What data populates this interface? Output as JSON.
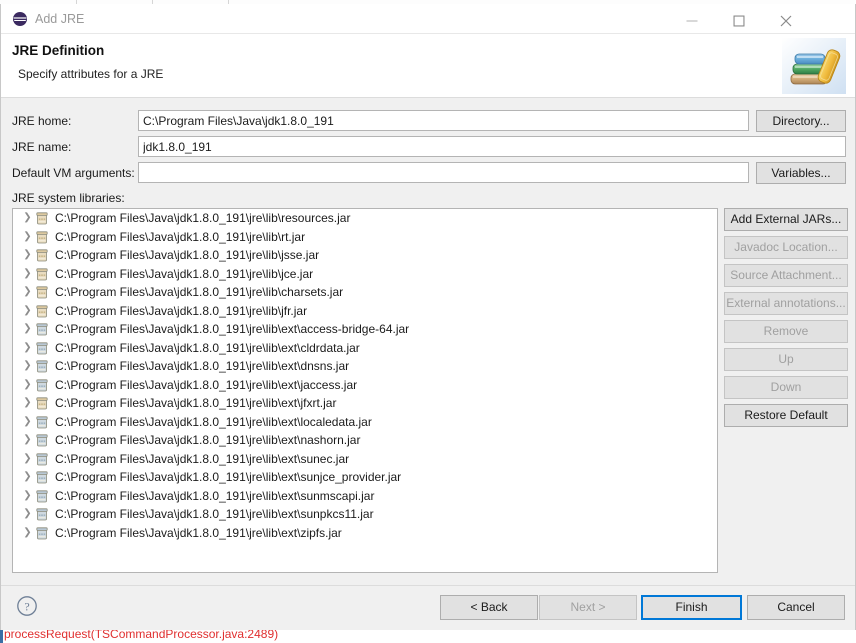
{
  "window": {
    "title": "Add JRE",
    "icon": "eclipse-icon",
    "minimize_label": "Minimize",
    "maximize_label": "Maximize",
    "close_label": "Close"
  },
  "header": {
    "title": "JRE Definition",
    "subtitle": "Specify attributes for a JRE",
    "image": "books-stack-icon"
  },
  "form": {
    "jre_home": {
      "label": "JRE home:",
      "value": "C:\\Program Files\\Java\\jdk1.8.0_191",
      "placeholder": ""
    },
    "jre_name": {
      "label": "JRE name:",
      "value": "jdk1.8.0_191",
      "placeholder": ""
    },
    "vm_args": {
      "label": "Default VM arguments:",
      "value": "",
      "placeholder": ""
    },
    "directory_button": "Directory...",
    "variables_button": "Variables...",
    "libraries_label": "JRE system libraries:"
  },
  "libraries": [
    {
      "path": "C:\\Program Files\\Java\\jdk1.8.0_191\\jre\\lib\\resources.jar",
      "icon": "jar-icon",
      "kind": "lib"
    },
    {
      "path": "C:\\Program Files\\Java\\jdk1.8.0_191\\jre\\lib\\rt.jar",
      "icon": "jar-icon",
      "kind": "lib"
    },
    {
      "path": "C:\\Program Files\\Java\\jdk1.8.0_191\\jre\\lib\\jsse.jar",
      "icon": "jar-icon",
      "kind": "lib"
    },
    {
      "path": "C:\\Program Files\\Java\\jdk1.8.0_191\\jre\\lib\\jce.jar",
      "icon": "jar-icon",
      "kind": "lib"
    },
    {
      "path": "C:\\Program Files\\Java\\jdk1.8.0_191\\jre\\lib\\charsets.jar",
      "icon": "jar-icon",
      "kind": "lib"
    },
    {
      "path": "C:\\Program Files\\Java\\jdk1.8.0_191\\jre\\lib\\jfr.jar",
      "icon": "jar-icon",
      "kind": "lib"
    },
    {
      "path": "C:\\Program Files\\Java\\jdk1.8.0_191\\jre\\lib\\ext\\access-bridge-64.jar",
      "icon": "jar-icon",
      "kind": "ext"
    },
    {
      "path": "C:\\Program Files\\Java\\jdk1.8.0_191\\jre\\lib\\ext\\cldrdata.jar",
      "icon": "jar-icon",
      "kind": "ext"
    },
    {
      "path": "C:\\Program Files\\Java\\jdk1.8.0_191\\jre\\lib\\ext\\dnsns.jar",
      "icon": "jar-icon",
      "kind": "ext"
    },
    {
      "path": "C:\\Program Files\\Java\\jdk1.8.0_191\\jre\\lib\\ext\\jaccess.jar",
      "icon": "jar-icon",
      "kind": "ext"
    },
    {
      "path": "C:\\Program Files\\Java\\jdk1.8.0_191\\jre\\lib\\ext\\jfxrt.jar",
      "icon": "jar-icon",
      "kind": "lib"
    },
    {
      "path": "C:\\Program Files\\Java\\jdk1.8.0_191\\jre\\lib\\ext\\localedata.jar",
      "icon": "jar-icon",
      "kind": "ext"
    },
    {
      "path": "C:\\Program Files\\Java\\jdk1.8.0_191\\jre\\lib\\ext\\nashorn.jar",
      "icon": "jar-icon",
      "kind": "ext"
    },
    {
      "path": "C:\\Program Files\\Java\\jdk1.8.0_191\\jre\\lib\\ext\\sunec.jar",
      "icon": "jar-icon",
      "kind": "ext"
    },
    {
      "path": "C:\\Program Files\\Java\\jdk1.8.0_191\\jre\\lib\\ext\\sunjce_provider.jar",
      "icon": "jar-icon",
      "kind": "ext"
    },
    {
      "path": "C:\\Program Files\\Java\\jdk1.8.0_191\\jre\\lib\\ext\\sunmscapi.jar",
      "icon": "jar-icon",
      "kind": "ext"
    },
    {
      "path": "C:\\Program Files\\Java\\jdk1.8.0_191\\jre\\lib\\ext\\sunpkcs11.jar",
      "icon": "jar-icon",
      "kind": "ext"
    },
    {
      "path": "C:\\Program Files\\Java\\jdk1.8.0_191\\jre\\lib\\ext\\zipfs.jar",
      "icon": "jar-icon",
      "kind": "ext"
    }
  ],
  "side_buttons": [
    {
      "label": "Add External JARs...",
      "enabled": true
    },
    {
      "label": "Javadoc Location...",
      "enabled": false
    },
    {
      "label": "Source Attachment...",
      "enabled": false
    },
    {
      "label": "External annotations...",
      "enabled": false
    },
    {
      "label": "Remove",
      "enabled": false
    },
    {
      "label": "Up",
      "enabled": false
    },
    {
      "label": "Down",
      "enabled": false
    },
    {
      "label": "Restore Default",
      "enabled": true
    }
  ],
  "footer": {
    "help_icon": "help-circle-icon",
    "back": "< Back",
    "next": "Next >",
    "next_enabled": false,
    "finish": "Finish",
    "finish_default": true,
    "cancel": "Cancel"
  },
  "background_editor": {
    "stack_trace_line": "processRequest(TSCommandProcessor.java:2489)"
  },
  "colors": {
    "accent": "#0078d7",
    "dialog_bg": "#f0f0f0",
    "button_bg": "#e1e1e1",
    "disabled_text": "#a0a0a0",
    "error_text": "#e03030"
  }
}
